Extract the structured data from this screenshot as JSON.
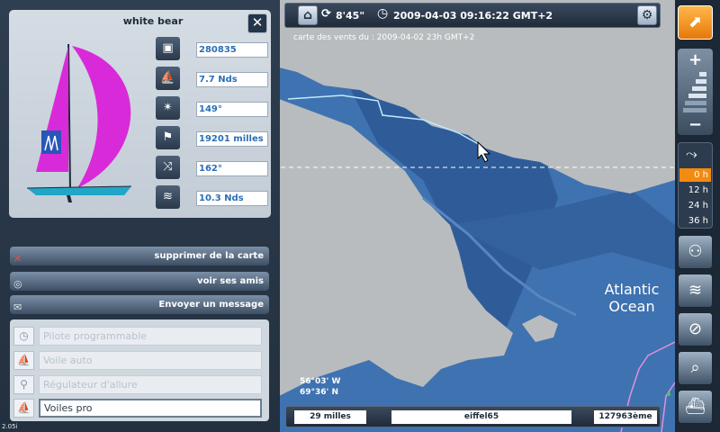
{
  "map": {
    "wind_caption": "carte des vents du :  2009-04-02 23h GMT+2",
    "ocean_label": "Atlantic Ocean",
    "lon": "56°03' W",
    "lat": "69°36' N"
  },
  "topbar": {
    "home_icon": "home-icon",
    "refresh_icon": "refresh-icon",
    "refresh_delay": "8'45\"",
    "clock_icon": "clock-icon",
    "datetime": "2009-04-03 09:16:22 GMT+2",
    "settings_icon": "gear-icon"
  },
  "boat": {
    "name": "white bear",
    "stats": [
      {
        "icon": "boat-id-icon",
        "glyph": "▣",
        "value": "280835"
      },
      {
        "icon": "sail-speed-icon",
        "glyph": "⛵",
        "value": "7.7 Nds"
      },
      {
        "icon": "compass-icon",
        "glyph": "✴",
        "value": "149°"
      },
      {
        "icon": "distance-icon",
        "glyph": "⚑",
        "value": "19201 milles"
      },
      {
        "icon": "wind-direction-icon",
        "glyph": "⤨",
        "value": "162°"
      },
      {
        "icon": "wind-speed-icon",
        "glyph": "≋",
        "value": "10.3 Nds"
      }
    ]
  },
  "actions": {
    "remove_label": "supprimer de la carte",
    "friends_label": "voir ses amis",
    "message_label": "Envoyer un message"
  },
  "autopilot": {
    "items": [
      {
        "label": "Pilote programmable",
        "active": false
      },
      {
        "label": "Voile auto",
        "active": false
      },
      {
        "label": "Régulateur d'allure",
        "active": false
      },
      {
        "label": "Voiles pro",
        "active": true
      }
    ]
  },
  "bottombar": {
    "distance": "29 milles",
    "player": "eiffel65",
    "rank": "127963ème"
  },
  "timeline": [
    "0 h",
    "12 h",
    "24 h",
    "36 h"
  ],
  "version": "2.05i",
  "colors": {
    "sea": "#3f72b0",
    "deep_sea": "#2f5c99",
    "land": "#b9bcbe",
    "accent": "#f28b0f",
    "sail": "#d92ad9"
  }
}
